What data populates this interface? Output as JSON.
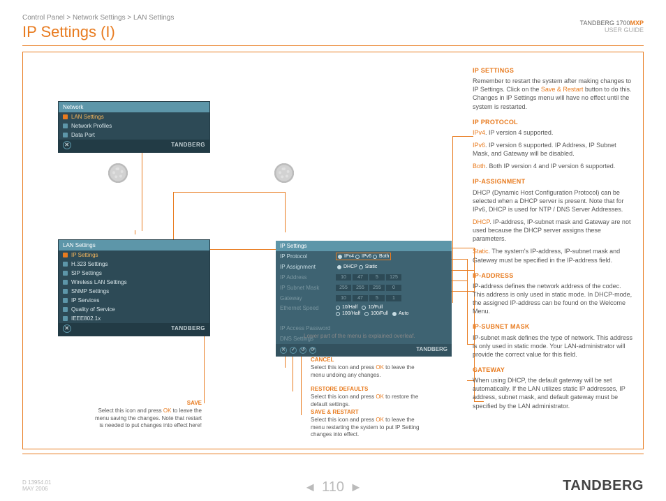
{
  "breadcrumb": "Control Panel > Network Settings > LAN Settings",
  "page_title": "IP Settings (I)",
  "product": {
    "brand": "TANDBERG 1700",
    "suffix": "MXP",
    "subtitle": "USER GUIDE"
  },
  "footer": {
    "doc": "D 13954.01",
    "date": "MAY 2006",
    "page": "110",
    "brand": "TANDBERG"
  },
  "network_menu": {
    "title": "Network",
    "items": [
      "LAN Settings",
      "Network Profiles",
      "Data Port"
    ],
    "brand": "TANDBERG"
  },
  "lan_menu": {
    "title": "LAN Settings",
    "items": [
      "IP Settings",
      "H.323 Settings",
      "SIP Settings",
      "Wireless LAN Settings",
      "SNMP Settings",
      "IP Services",
      "Quality of Service",
      "IEEE802.1x"
    ],
    "brand": "TANDBERG"
  },
  "ip_panel": {
    "title": "IP Settings",
    "rows": {
      "ip_protocol": "IP Protocol",
      "ip_assignment": "IP Assignment",
      "ip_address": "IP Address",
      "ip_subnet": "IP Subnet Mask",
      "gateway": "Gateway",
      "eth_speed": "Ethernet Speed",
      "ip_pw": "IP Access Password",
      "dns": "DNS Settings"
    },
    "protocol_options": [
      "IPv4",
      "IPv6",
      "Both"
    ],
    "assign_options": [
      "DHCP",
      "Static"
    ],
    "ip_address_octets": [
      "10",
      "47",
      "5",
      "125"
    ],
    "subnet_octets": [
      "255",
      "255",
      "255",
      "0"
    ],
    "gateway_octets": [
      "10",
      "47",
      "5",
      "1"
    ],
    "eth_row1": [
      "10/Half",
      "10/Full"
    ],
    "eth_row2": [
      "100/Half",
      "100/Full",
      "Auto"
    ],
    "brand": "TANDBERG"
  },
  "note_overleaf": "Lower part of the menu is explained overleaf.",
  "callouts": {
    "save": {
      "title": "SAVE",
      "body_pre": "Select this icon and press ",
      "ok": "OK",
      "body_post": " to leave the menu saving the changes. Note that restart is needed to put changes into effect here!"
    },
    "cancel": {
      "title": "CANCEL",
      "body_pre": "Select this icon and press ",
      "ok": "OK",
      "body_post": " to leave the menu undoing any changes."
    },
    "restore": {
      "title": "RESTORE DEFAULTS",
      "body_pre": "Select this icon and press ",
      "ok": "OK",
      "body_post": " to restore the default settings."
    },
    "savers": {
      "title": "SAVE & RESTART",
      "body_pre": "Select this icon and press ",
      "ok": "OK",
      "body_post": " to leave the menu restarting the system to put IP Setting changes into effect."
    }
  },
  "help": {
    "ip_settings": {
      "h": "IP SETTINGS",
      "p1_pre": "Remember to restart the system after making changes to IP Settings. Click on the ",
      "kw": "Save & Restart",
      "p1_post": " button to do this. Changes in IP Settings menu will have no effect until the system is restarted."
    },
    "ip_protocol": {
      "h": "IP PROTOCOL",
      "l1_kw": "IPv4",
      "l1": ". IP version 4 supported.",
      "l2_kw": "IPv6",
      "l2": ". IP version 6 supported. IP Address, IP Subnet Mask, and Gateway will be disabled.",
      "l3_kw": "Both",
      "l3": ". Both IP version 4 and IP version 6 supported."
    },
    "ip_assignment": {
      "h": "IP-ASSIGNMENT",
      "p1": "DHCP (Dynamic Host Configuration Protocol) can be selected when a DHCP server is present. Note that for IPv6, DHCP is used for  NTP / DNS Server Addresses.",
      "l1_kw": "DHCP",
      "l1": ". IP-address, IP-subnet mask and Gateway are not used because the DHCP server assigns these parameters.",
      "l2_kw": "Static",
      "l2": ". The system's IP-address, IP-subnet mask and Gateway must be specified in the IP-address field."
    },
    "ip_address": {
      "h": "IP-ADDRESS",
      "p": "IP-address defines the network address of the codec. This address is only used in static mode. In DHCP-mode, the assigned IP-address can be found on the Welcome Menu."
    },
    "ip_subnet": {
      "h": "IP-SUBNET MASK",
      "p": "IP-subnet mask defines the type of network. This address is only used in static mode. Your LAN-administrator will provide the correct value for this field."
    },
    "gateway": {
      "h": "GATEWAY",
      "p": "When using DHCP, the default gateway will be set automatically. If the LAN utilizes static IP addresses, IP address, subnet mask, and default gateway must be specified by the LAN administrator."
    }
  }
}
